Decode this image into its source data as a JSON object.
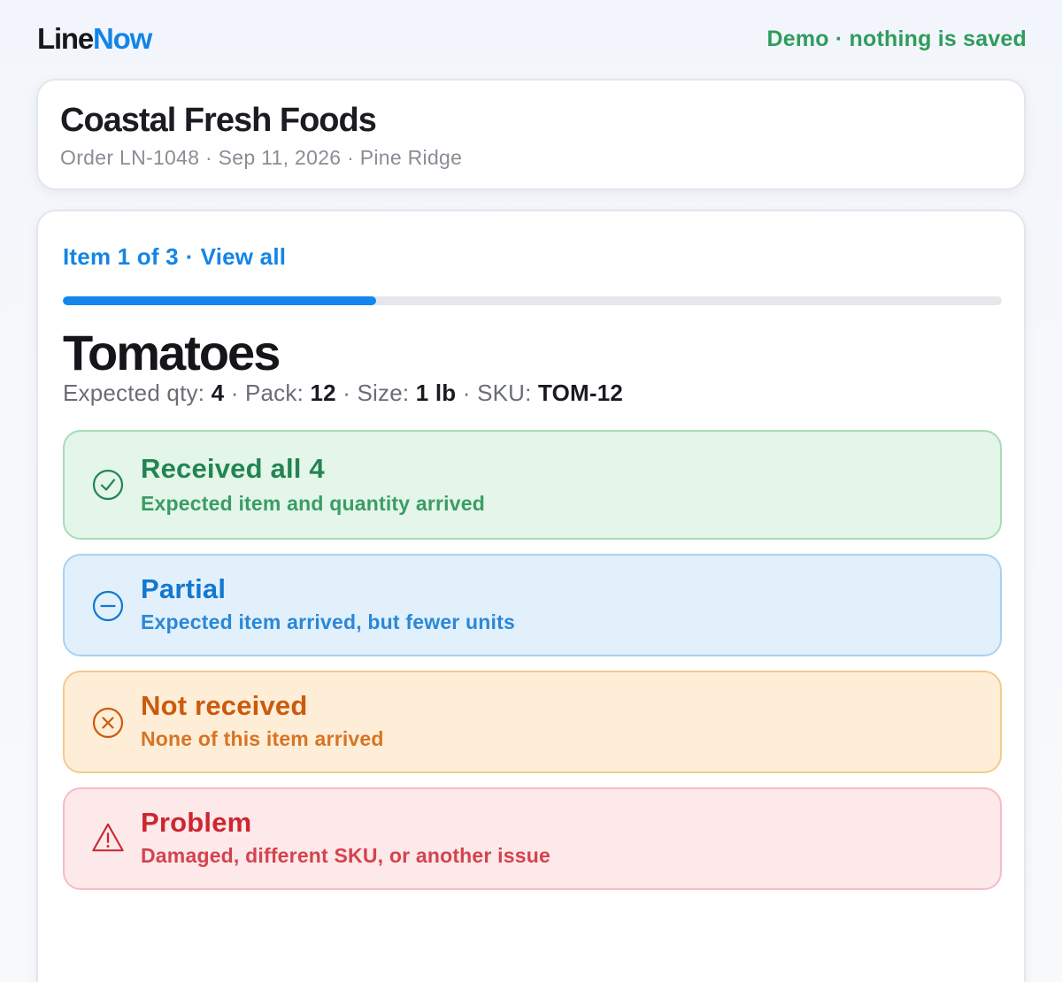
{
  "app": {
    "brand_part1": "Line",
    "brand_part2": "Now",
    "demo_note": "Demo · nothing is saved"
  },
  "order": {
    "vendor": "Coastal Fresh Foods",
    "meta": "Order LN-1048 · Sep 11, 2026 · Pine Ridge"
  },
  "progress": {
    "label": "Item 1 of 3",
    "separator": "·",
    "view_all": "View all",
    "fraction": 0.3333
  },
  "item": {
    "name": "Tomatoes",
    "expected_qty_label": "Expected qty:",
    "expected_qty": "4",
    "pack_label": "Pack:",
    "pack": "12",
    "size_label": "Size:",
    "size": "1 lb",
    "sku_label": "SKU:",
    "sku": "TOM-12",
    "sep": "·"
  },
  "options": {
    "received": {
      "title": "Received all 4",
      "desc": "Expected item and quantity arrived",
      "icon": "check-circle-icon",
      "color": "#218552"
    },
    "partial": {
      "title": "Partial",
      "desc": "Expected item arrived, but fewer units",
      "icon": "minus-circle-icon",
      "color": "#1278cf"
    },
    "not_received": {
      "title": "Not received",
      "desc": "None of this item arrived",
      "icon": "x-circle-icon",
      "color": "#cc5a0c"
    },
    "problem": {
      "title": "Problem",
      "desc": "Damaged, different SKU, or another issue",
      "icon": "warning-triangle-icon",
      "color": "#cc2630"
    }
  },
  "colors": {
    "accent": "#1287ee",
    "demo_green": "#2f9c5c"
  }
}
